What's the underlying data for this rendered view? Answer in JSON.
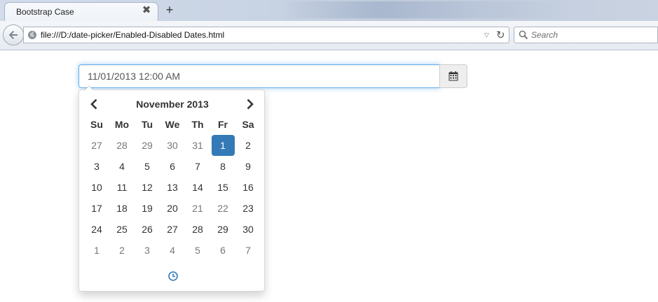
{
  "browser": {
    "tab_title": "Bootstrap Case",
    "tab_close": "✖",
    "new_tab": "+",
    "url": "file:///D:/date-picker/Enabled-Disabled Dates.html",
    "search_placeholder": "Search",
    "dropmarker": "▽",
    "reload": "↻"
  },
  "datetime": {
    "value": "11/01/2013 12:00 AM"
  },
  "calendar": {
    "month_title": "November 2013",
    "weekdays": [
      "Su",
      "Mo",
      "Tu",
      "We",
      "Th",
      "Fr",
      "Sa"
    ],
    "weeks": [
      [
        {
          "d": "27",
          "muted": true
        },
        {
          "d": "28",
          "muted": true
        },
        {
          "d": "29",
          "muted": true
        },
        {
          "d": "30",
          "muted": true
        },
        {
          "d": "31",
          "muted": true
        },
        {
          "d": "1",
          "active": true
        },
        {
          "d": "2"
        }
      ],
      [
        {
          "d": "3"
        },
        {
          "d": "4"
        },
        {
          "d": "5"
        },
        {
          "d": "6"
        },
        {
          "d": "7"
        },
        {
          "d": "8"
        },
        {
          "d": "9"
        }
      ],
      [
        {
          "d": "10"
        },
        {
          "d": "11"
        },
        {
          "d": "12"
        },
        {
          "d": "13"
        },
        {
          "d": "14"
        },
        {
          "d": "15"
        },
        {
          "d": "16"
        }
      ],
      [
        {
          "d": "17"
        },
        {
          "d": "18"
        },
        {
          "d": "19"
        },
        {
          "d": "20"
        },
        {
          "d": "21",
          "muted": true
        },
        {
          "d": "22",
          "muted": true
        },
        {
          "d": "23"
        }
      ],
      [
        {
          "d": "24"
        },
        {
          "d": "25"
        },
        {
          "d": "26"
        },
        {
          "d": "27"
        },
        {
          "d": "28"
        },
        {
          "d": "29"
        },
        {
          "d": "30"
        }
      ],
      [
        {
          "d": "1",
          "muted": true
        },
        {
          "d": "2",
          "muted": true
        },
        {
          "d": "3",
          "muted": true
        },
        {
          "d": "4",
          "muted": true
        },
        {
          "d": "5",
          "muted": true
        },
        {
          "d": "6",
          "muted": true
        },
        {
          "d": "7",
          "muted": true
        }
      ]
    ]
  },
  "colors": {
    "active_day_bg": "#337ab7",
    "focus_border": "#66afe9",
    "muted_day": "#777777",
    "clock_icon": "#337ab7"
  },
  "icons": {
    "back": "back-arrow-icon",
    "site": "globe-icon",
    "search": "search-icon",
    "addon": "calendar-icon",
    "prev": "chevron-left-icon",
    "next": "chevron-right-icon",
    "time": "clock-icon"
  }
}
